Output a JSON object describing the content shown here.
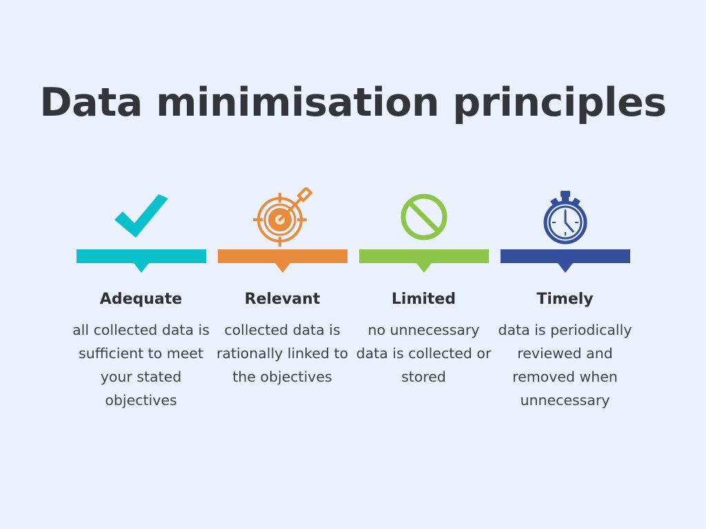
{
  "background_color": "#ebf2fd",
  "title": "Data minimisation principles",
  "title_color": "#32353a",
  "columns": [
    {
      "icon": "check-mark-icon",
      "color": "#0ac0cb",
      "heading": "Adequate",
      "body": "all collected data is sufficient to meet your stated objectives"
    },
    {
      "icon": "target-with-arrow-icon",
      "color": "#e88b3c",
      "heading": "Relevant",
      "body": "collected data is rationally linked to the objectives"
    },
    {
      "icon": "prohibition-icon",
      "color": "#8dc44a",
      "heading": "Limited",
      "body": "no unnecessary data is collected or stored"
    },
    {
      "icon": "stopwatch-icon",
      "color": "#34509c",
      "heading": "Timely",
      "body": "data is periodically reviewed and removed when unnecessary"
    }
  ]
}
